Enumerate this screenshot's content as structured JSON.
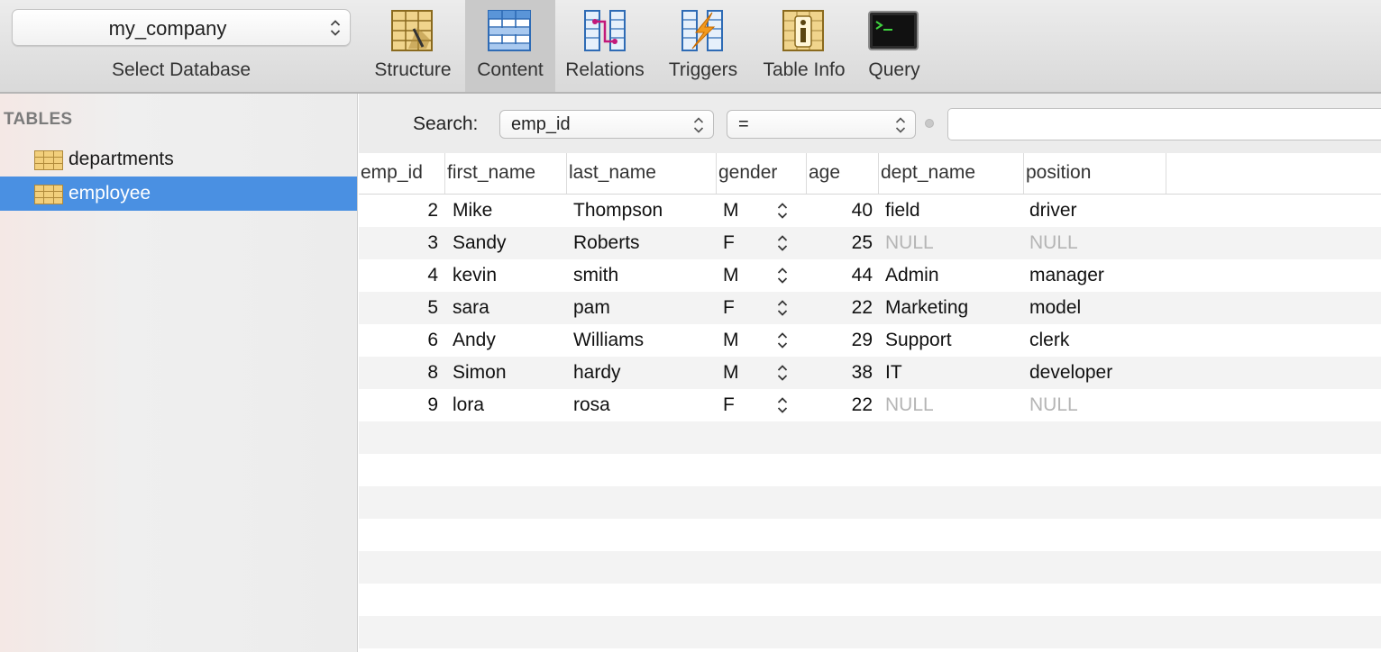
{
  "database": {
    "selected": "my_company",
    "caption": "Select Database"
  },
  "toolbar": {
    "buttons": [
      {
        "label": "Structure",
        "icon": "structure-icon"
      },
      {
        "label": "Content",
        "icon": "content-icon",
        "active": true
      },
      {
        "label": "Relations",
        "icon": "relations-icon"
      },
      {
        "label": "Triggers",
        "icon": "triggers-icon"
      },
      {
        "label": "Table Info",
        "icon": "table-info-icon"
      },
      {
        "label": "Query",
        "icon": "query-icon"
      }
    ]
  },
  "sidebar": {
    "heading": "TABLES",
    "tables": [
      {
        "name": "departments",
        "selected": false
      },
      {
        "name": "employee",
        "selected": true
      }
    ]
  },
  "search": {
    "label": "Search:",
    "field": "emp_id",
    "operator": "=",
    "value": ""
  },
  "table": {
    "columns": [
      "emp_id",
      "first_name",
      "last_name",
      "gender",
      "age",
      "dept_name",
      "position"
    ],
    "rows": [
      {
        "emp_id": "2",
        "first_name": "Mike",
        "last_name": "Thompson",
        "gender": "M",
        "age": "40",
        "dept_name": "field",
        "position": "driver"
      },
      {
        "emp_id": "3",
        "first_name": "Sandy",
        "last_name": "Roberts",
        "gender": "F",
        "age": "25",
        "dept_name": "NULL",
        "position": "NULL"
      },
      {
        "emp_id": "4",
        "first_name": "kevin",
        "last_name": "smith",
        "gender": "M",
        "age": "44",
        "dept_name": "Admin",
        "position": "manager"
      },
      {
        "emp_id": "5",
        "first_name": "sara",
        "last_name": "pam",
        "gender": "F",
        "age": "22",
        "dept_name": "Marketing",
        "position": "model"
      },
      {
        "emp_id": "6",
        "first_name": "Andy",
        "last_name": "Williams",
        "gender": "M",
        "age": "29",
        "dept_name": "Support",
        "position": "clerk"
      },
      {
        "emp_id": "8",
        "first_name": "Simon",
        "last_name": "hardy",
        "gender": "M",
        "age": "38",
        "dept_name": "IT",
        "position": "developer"
      },
      {
        "emp_id": "9",
        "first_name": "lora",
        "last_name": "rosa",
        "gender": "F",
        "age": "22",
        "dept_name": "NULL",
        "position": "NULL"
      }
    ]
  },
  "colors": {
    "selection": "#4a90e2",
    "null_text": "#b5b5b5",
    "stripe": "#f3f3f3"
  }
}
